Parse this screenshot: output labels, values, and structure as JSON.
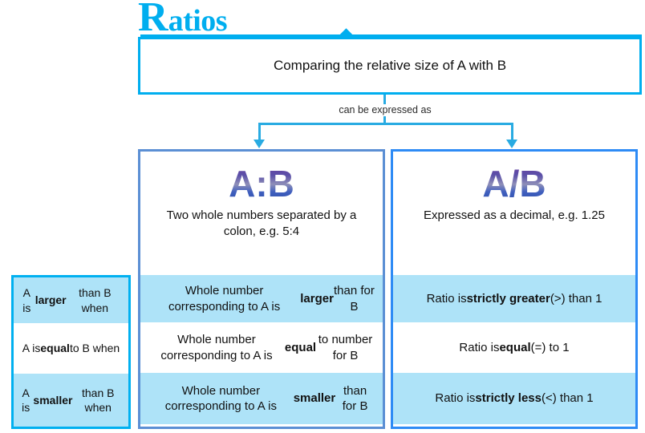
{
  "title": {
    "cap": "R",
    "rest": "atios"
  },
  "top_box": {
    "text": "Comparing the relative size of A with B"
  },
  "connector": {
    "label": "can be expressed as"
  },
  "options": [
    {
      "id": "colon",
      "symbol": "A:B",
      "description": "Two whole numbers separated by a colon, e.g. 5:4",
      "border_color": "#5B8FD4"
    },
    {
      "id": "fraction",
      "symbol": "A/B",
      "description": "Expressed as a decimal, e.g. 1.25",
      "border_color": "#2E8BF5"
    }
  ],
  "comparison": {
    "condition_column": {
      "border_color": "#00B0F0",
      "cells": [
        {
          "html": "A is <b>larger</b> than B when",
          "shaded": true
        },
        {
          "html": "A is <b>equal</b> to B when",
          "shaded": false
        },
        {
          "html": "A is <b>smaller</b> than B when",
          "shaded": true
        }
      ]
    },
    "colon_column": {
      "border_color": "#5B8FD4",
      "cells": [
        {
          "html": "Whole number corresponding to A is <b>larger</b> than for B",
          "shaded": true
        },
        {
          "html": "Whole number corresponding to A is <b>equal</b> to number for B",
          "shaded": false
        },
        {
          "html": "Whole number corresponding to A is <b>smaller</b> than for B",
          "shaded": true
        }
      ]
    },
    "fraction_column": {
      "border_color": "#2E8BF5",
      "cells": [
        {
          "html": "Ratio is <b>strictly greater</b> (&gt;) than 1",
          "shaded": true
        },
        {
          "html": "Ratio is <b>equal</b> (=) to 1",
          "shaded": false
        },
        {
          "html": "Ratio is <b>strictly less</b> (&lt;) than 1",
          "shaded": true
        }
      ]
    }
  },
  "colors": {
    "accent_cyan": "#00AEEF",
    "connector_blue": "#29ABE2",
    "shade_blue": "#AEE3F8",
    "symbol_gradient_start": "#6A3FA0",
    "symbol_gradient_end": "#2F4FA8"
  }
}
